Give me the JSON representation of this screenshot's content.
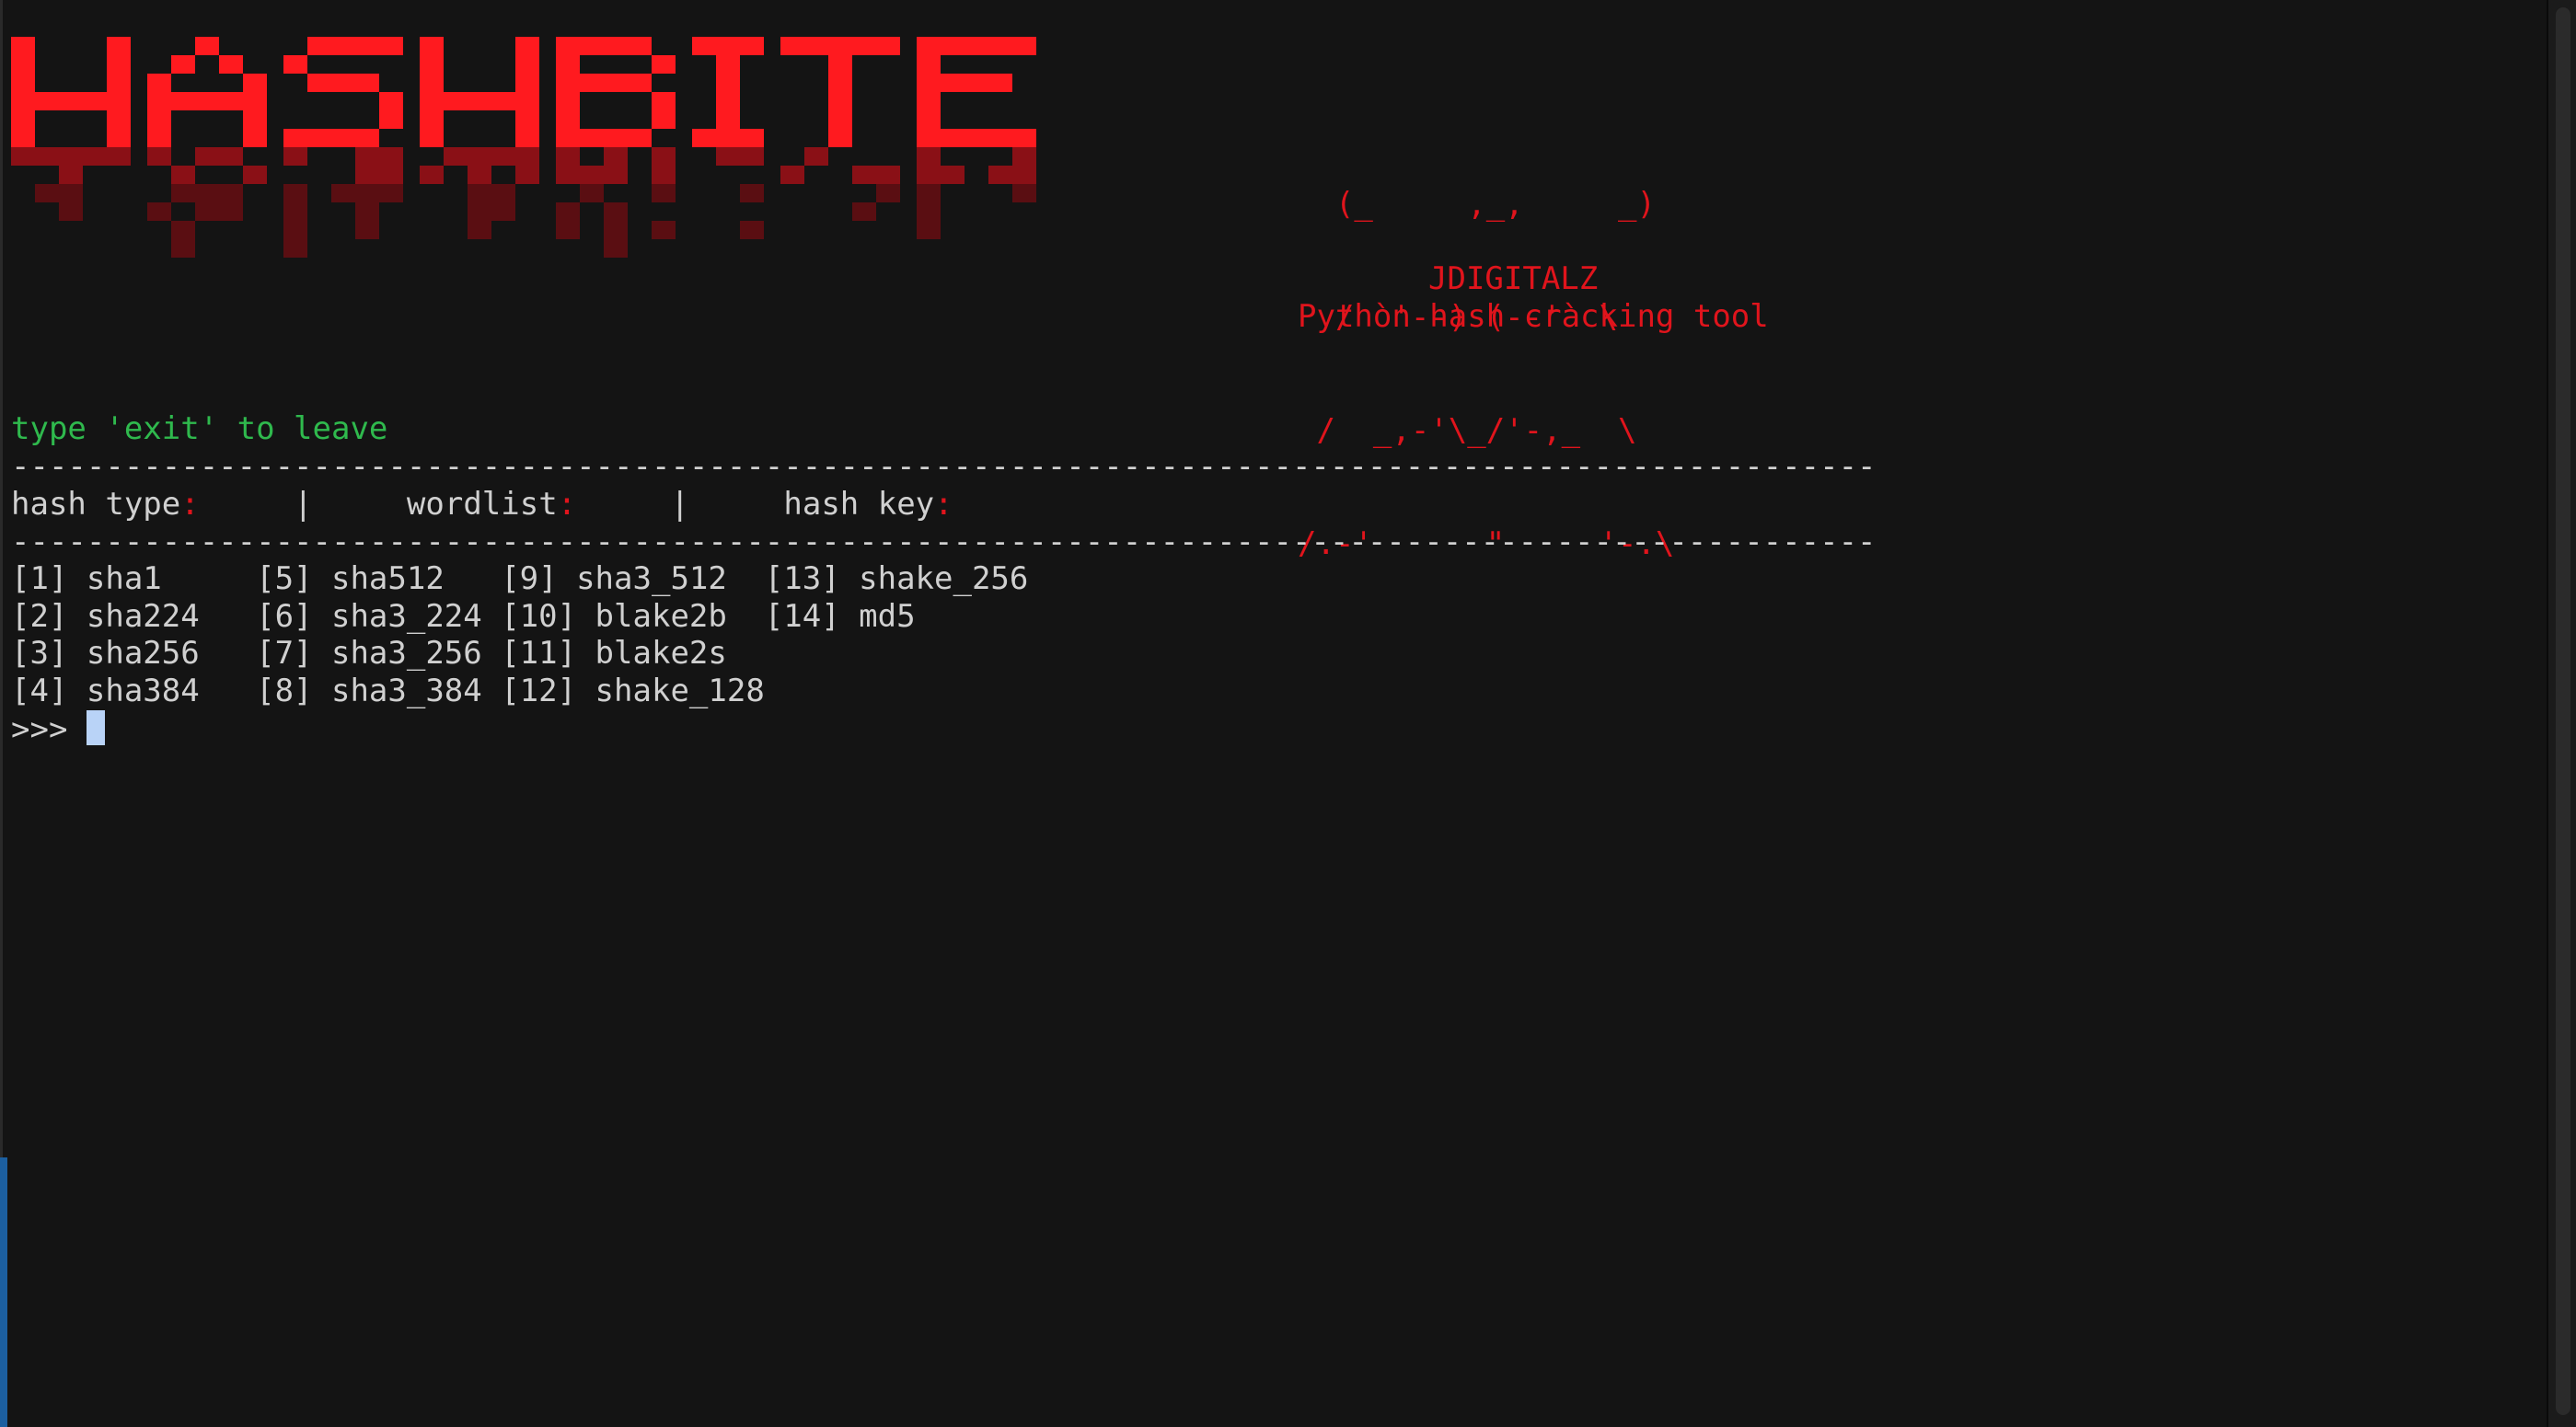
{
  "logo": {
    "text": "HASHBITE",
    "color": "#ff1a1f",
    "drip_color": "#5a0e12"
  },
  "bat_art": [
    "  (_     ,_,     _)",
    "  / `'--) (--'` \\",
    " /  _,-'\\_/'-,_  \\",
    "/.-'      \"     '-.\\"
  ],
  "author": "JDIGITALZ",
  "tagline": "Python hash cracking tool",
  "exit_hint": "type 'exit' to leave",
  "separator": "---------------------------------------------------------------------------------------------------",
  "header": {
    "hash_type_label": "hash type",
    "wordlist_label": "wordlist",
    "hash_key_label": "hash key",
    "colon": ":",
    "pipe": "|"
  },
  "hash_menu": [
    "[1] sha1     [5] sha512   [9] sha3_512  [13] shake_256",
    "[2] sha224   [6] sha3_224 [10] blake2b  [14] md5",
    "[3] sha256   [7] sha3_256 [11] blake2s",
    "[4] sha384   [8] sha3_384 [12] shake_128"
  ],
  "prompt": ">>> ",
  "colors": {
    "background": "#141414",
    "text": "#d0d0d0",
    "accent_red": "#e0141c",
    "hint_green": "#2fb94d",
    "cursor": "#b9d3f7"
  }
}
